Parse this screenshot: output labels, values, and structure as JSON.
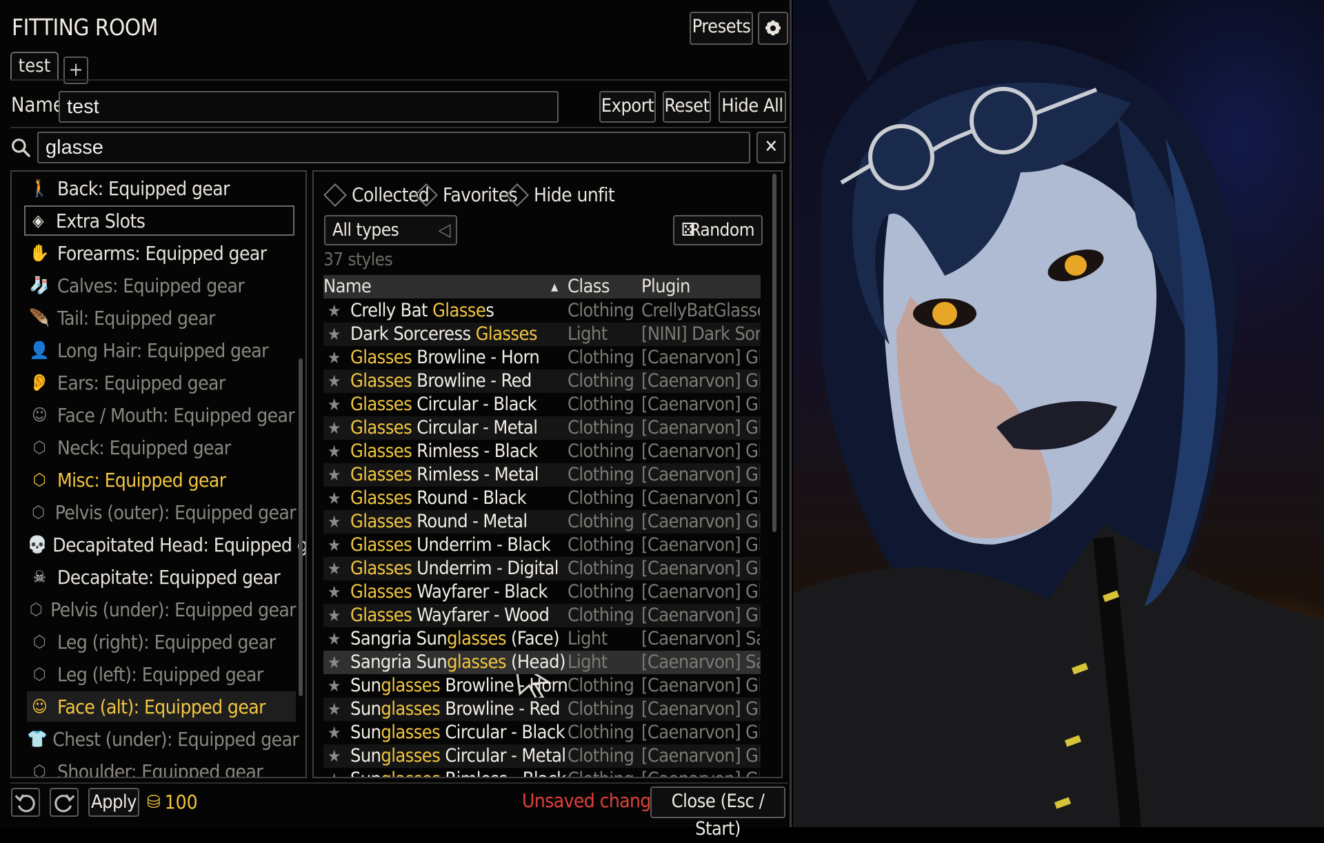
{
  "app": {
    "title": "FITTING ROOM"
  },
  "header": {
    "presets_label": "Presets",
    "settings_icon": "gear-icon"
  },
  "tabs": [
    {
      "label": "test"
    }
  ],
  "tab_add_label": "+",
  "name_field": {
    "label": "Name",
    "value": "test"
  },
  "actions": {
    "export": "Export",
    "reset": "Reset",
    "hide_all": "Hide All"
  },
  "search": {
    "value": "glasse",
    "clear_label": "✕",
    "icon": "search-icon"
  },
  "slots": [
    {
      "label": "Back: Equipped gear",
      "icon": "person-walk-icon",
      "state": "normal"
    },
    {
      "label": "Extra Slots",
      "icon": "gem-icon",
      "state": "group"
    },
    {
      "label": "Forearms: Equipped gear",
      "icon": "hand-icon",
      "state": "normal"
    },
    {
      "label": "Calves: Equipped gear",
      "icon": "socks-icon",
      "state": "dim"
    },
    {
      "label": "Tail: Equipped gear",
      "icon": "feather-icon",
      "state": "dim"
    },
    {
      "label": "Long Hair: Equipped gear",
      "icon": "person-icon",
      "state": "dim"
    },
    {
      "label": "Ears: Equipped gear",
      "icon": "ear-icon",
      "state": "dim"
    },
    {
      "label": "Face / Mouth: Equipped gear",
      "icon": "smile-icon",
      "state": "dim"
    },
    {
      "label": "Neck: Equipped gear",
      "icon": "box-icon",
      "state": "dim"
    },
    {
      "label": "Misc: Equipped gear",
      "icon": "box-icon",
      "state": "highlight"
    },
    {
      "label": "Pelvis (outer): Equipped gear",
      "icon": "box-icon",
      "state": "dim"
    },
    {
      "label": "Decapitated Head: Equipped gear",
      "icon": "skull-icon",
      "state": "normal"
    },
    {
      "label": "Decapitate: Equipped gear",
      "icon": "skull-crossbones-icon",
      "state": "normal"
    },
    {
      "label": "Pelvis (under): Equipped gear",
      "icon": "box-icon",
      "state": "dim"
    },
    {
      "label": "Leg (right): Equipped gear",
      "icon": "box-icon",
      "state": "dim"
    },
    {
      "label": "Leg (left): Equipped gear",
      "icon": "box-icon",
      "state": "dim"
    },
    {
      "label": "Face (alt): Equipped gear",
      "icon": "smile-icon",
      "state": "selected"
    },
    {
      "label": "Chest (under): Equipped gear",
      "icon": "shirt-icon",
      "state": "dim"
    },
    {
      "label": "Shoulder: Equipped gear",
      "icon": "box-icon",
      "state": "dim"
    }
  ],
  "filters": {
    "collected": "Collected",
    "favorites": "Favorites",
    "hide_unfit": "Hide unfit"
  },
  "type_select": {
    "value": "All types"
  },
  "random_label": "Random",
  "count_label": "37 styles",
  "columns": {
    "name": "Name",
    "class": "Class",
    "plugin": "Plugin",
    "sort_indicator": "▲"
  },
  "styles": [
    {
      "pre": "Crelly Bat ",
      "match": "Glasse",
      "post": "s",
      "class": "Clothing",
      "plugin": "CrellyBatGlasses.esp"
    },
    {
      "pre": "Dark Sorceress ",
      "match": "Glasses",
      "post": "",
      "class": "Light",
      "plugin": "[NINI] Dark Sorceress"
    },
    {
      "pre": "",
      "match": "Glasses",
      "post": " Browline - Horn",
      "class": "Clothing",
      "plugin": "[Caenarvon] Glasses"
    },
    {
      "pre": "",
      "match": "Glasses",
      "post": " Browline - Red",
      "class": "Clothing",
      "plugin": "[Caenarvon] Glasses"
    },
    {
      "pre": "",
      "match": "Glasses",
      "post": " Circular - Black",
      "class": "Clothing",
      "plugin": "[Caenarvon] Glasses"
    },
    {
      "pre": "",
      "match": "Glasses",
      "post": " Circular - Metal",
      "class": "Clothing",
      "plugin": "[Caenarvon] Glasses"
    },
    {
      "pre": "",
      "match": "Glasses",
      "post": " Rimless - Black",
      "class": "Clothing",
      "plugin": "[Caenarvon] Glasses"
    },
    {
      "pre": "",
      "match": "Glasses",
      "post": " Rimless - Metal",
      "class": "Clothing",
      "plugin": "[Caenarvon] Glasses"
    },
    {
      "pre": "",
      "match": "Glasses",
      "post": " Round - Black",
      "class": "Clothing",
      "plugin": "[Caenarvon] Glasses"
    },
    {
      "pre": "",
      "match": "Glasses",
      "post": " Round - Metal",
      "class": "Clothing",
      "plugin": "[Caenarvon] Glasses"
    },
    {
      "pre": "",
      "match": "Glasses",
      "post": " Underrim - Black",
      "class": "Clothing",
      "plugin": "[Caenarvon] Glasses"
    },
    {
      "pre": "",
      "match": "Glasses",
      "post": " Underrim - Digital",
      "class": "Clothing",
      "plugin": "[Caenarvon] Glasses"
    },
    {
      "pre": "",
      "match": "Glasses",
      "post": " Wayfarer - Black",
      "class": "Clothing",
      "plugin": "[Caenarvon] Glasses"
    },
    {
      "pre": "",
      "match": "Glasses",
      "post": " Wayfarer - Wood",
      "class": "Clothing",
      "plugin": "[Caenarvon] Glasses"
    },
    {
      "pre": "Sangria Sun",
      "match": "glasses",
      "post": " (Face)",
      "class": "Light",
      "plugin": "[Caenarvon] Sangria"
    },
    {
      "pre": "Sangria Sun",
      "match": "glasses",
      "post": " (Head)",
      "class": "Light",
      "plugin": "[Caenarvon] Sangria"
    },
    {
      "pre": "Sun",
      "match": "glasses",
      "post": " Browline - Horn",
      "class": "Clothing",
      "plugin": "[Caenarvon] Glasses"
    },
    {
      "pre": "Sun",
      "match": "glasses",
      "post": " Browline - Red",
      "class": "Clothing",
      "plugin": "[Caenarvon] Glasses"
    },
    {
      "pre": "Sun",
      "match": "glasses",
      "post": " Circular - Black",
      "class": "Clothing",
      "plugin": "[Caenarvon] Glasses"
    },
    {
      "pre": "Sun",
      "match": "glasses",
      "post": " Circular - Metal",
      "class": "Clothing",
      "plugin": "[Caenarvon] Glasses"
    },
    {
      "pre": "Sun",
      "match": "glasses",
      "post": " Rimless - Black",
      "class": "Clothing",
      "plugin": "[Caenarvon] Glasses"
    }
  ],
  "footer": {
    "apply": "Apply",
    "coins": "100",
    "unsaved": "Unsaved changes",
    "close": "Close (Esc / Start)"
  },
  "colors": {
    "highlight": "#f3c640",
    "unsaved": "#e0403a",
    "dim_text": "#8a8780"
  }
}
